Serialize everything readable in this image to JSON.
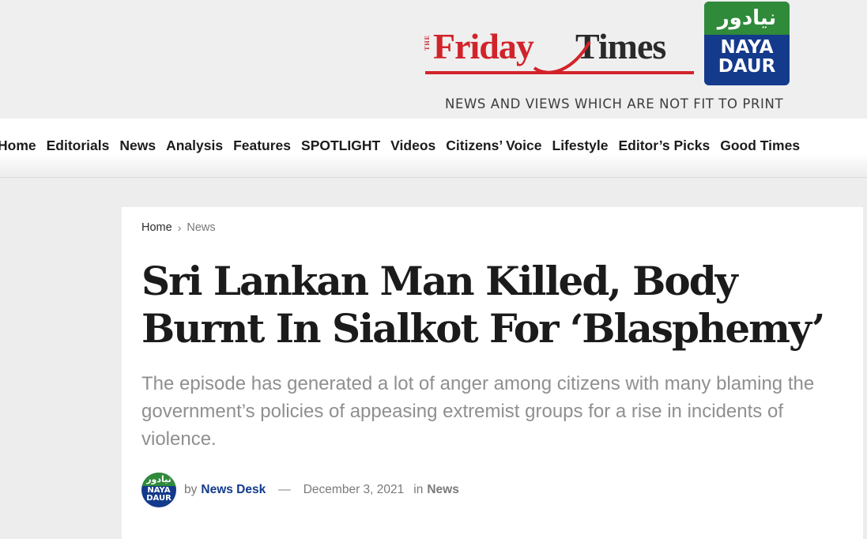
{
  "header": {
    "logo_the": "THE",
    "logo_friday": "Friday",
    "logo_times": "Times",
    "nayadaur_urdu": "نیادور",
    "nayadaur_line1": "NAYA",
    "nayadaur_line2": "DAUR",
    "tagline": "NEWS AND VIEWS WHICH ARE NOT FIT TO PRINT"
  },
  "nav": {
    "items": [
      "Home",
      "Editorials",
      "News",
      "Analysis",
      "Features",
      "SPOTLIGHT",
      "Videos",
      "Citizens’ Voice",
      "Lifestyle",
      "Editor’s Picks",
      "Good Times"
    ]
  },
  "breadcrumb": {
    "home": "Home",
    "separator": "›",
    "current": "News"
  },
  "article": {
    "headline": "Sri Lankan Man Killed, Body Burnt In Sialkot For ‘Blasphemy’",
    "deck": "The episode has generated a lot of anger among citizens with many blaming the government’s policies of appeasing extremist groups for a rise in incidents of violence.",
    "by_label": "by",
    "author": "News Desk",
    "dash": "—",
    "date": "December 3, 2021",
    "in_label": "in",
    "category": "News"
  },
  "colors": {
    "brand_red": "#d2232a",
    "nayadaur_blue": "#143a8c",
    "nayadaur_green": "#2f8a3a",
    "author_link": "#123a8c"
  }
}
